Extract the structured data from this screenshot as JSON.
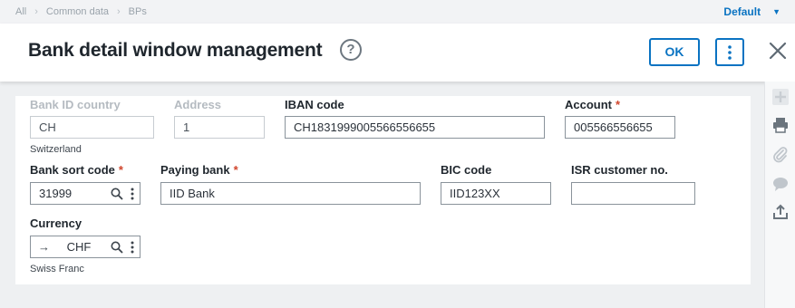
{
  "breadcrumb": [
    "All",
    "Common data",
    "BPs"
  ],
  "default_label": "Default",
  "title": "Bank detail window management",
  "ok_label": "OK",
  "accent_color": "#0a73c2",
  "required_color": "#d0452c",
  "fields": {
    "bank_id_country": {
      "label": "Bank ID country",
      "value": "CH",
      "sub": "Switzerland"
    },
    "address": {
      "label": "Address",
      "value": "1"
    },
    "iban": {
      "label": "IBAN code",
      "value": "CH1831999005566556655"
    },
    "account": {
      "label": "Account",
      "value": "005566556655"
    },
    "bank_sort_code": {
      "label": "Bank sort code",
      "value": "31999"
    },
    "paying_bank": {
      "label": "Paying bank",
      "value": "IID Bank"
    },
    "bic": {
      "label": "BIC code",
      "value": "IID123XX"
    },
    "isr": {
      "label": "ISR customer no.",
      "value": ""
    },
    "currency": {
      "label": "Currency",
      "value": "CHF",
      "sub": "Swiss Franc"
    }
  },
  "required_mark": "*",
  "rail_icons": [
    "plus-icon",
    "print-icon",
    "paperclip-icon",
    "comment-icon",
    "share-icon"
  ]
}
